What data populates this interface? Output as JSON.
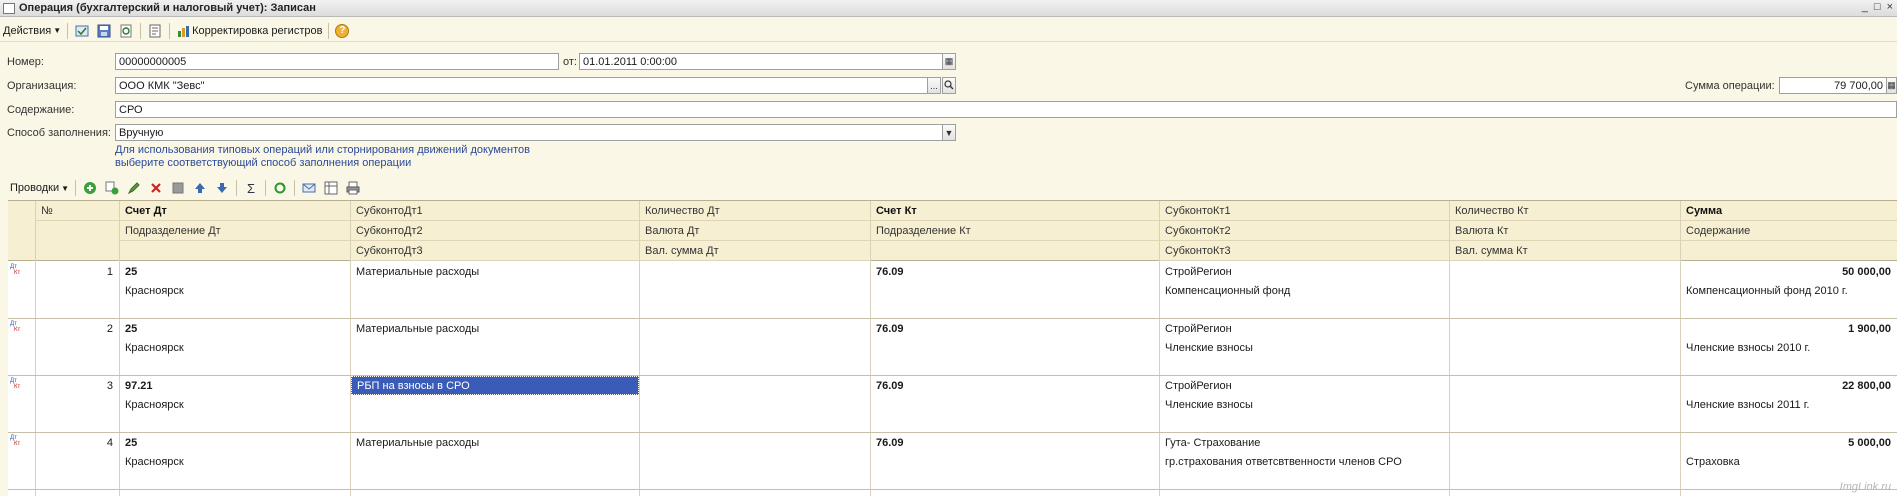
{
  "window": {
    "title": "Операция (бухгалтерский и налоговый учет): Записан",
    "controls": [
      "_",
      "□",
      "×"
    ]
  },
  "toolbar": {
    "actions_label": "Действия",
    "registers_label": "Корректировка регистров",
    "help_glyph": "?"
  },
  "form": {
    "number_label": "Номер:",
    "number_value": "00000000005",
    "date_label": "от:",
    "date_value": "01.01.2011  0:00:00",
    "org_label": "Организация:",
    "org_value": "ООО КМК \"Зевс\"",
    "org_select_glyph": "...",
    "sum_label": "Сумма операции:",
    "sum_value": "79 700,00",
    "content_label": "Содержание:",
    "content_value": "СРО",
    "fill_label": "Способ заполнения:",
    "fill_value": "Вручную",
    "hint_line1": "Для использования типовых операций или сторнирования движений документов",
    "hint_line2": "выберите соответствующий способ заполнения операции"
  },
  "entries_toolbar": {
    "label": "Проводки"
  },
  "grid": {
    "headers": {
      "num": "№",
      "dt_account": "Счет Дт",
      "dt_division": "Подразделение Дт",
      "dt_sub1": "СубконтоДт1",
      "dt_sub2": "СубконтоДт2",
      "dt_sub3": "СубконтоДт3",
      "dt_qty": "Количество Дт",
      "dt_currency": "Валюта Дт",
      "dt_cur_sum": "Вал. сумма Дт",
      "kt_account": "Счет Кт",
      "kt_division": "Подразделение Кт",
      "kt_sub1": "СубконтоКт1",
      "kt_sub2": "СубконтоКт2",
      "kt_sub3": "СубконтоКт3",
      "kt_qty": "Количество Кт",
      "kt_currency": "Валюта Кт",
      "kt_cur_sum": "Вал. сумма Кт",
      "sum": "Сумма",
      "content": "Содержание"
    },
    "rows": [
      {
        "icon_dt": "Дт",
        "icon_kt": "Кт",
        "num": "1",
        "dt_account": "25",
        "dt_division": "Красноярск",
        "dt_sub1": "Материальные расходы",
        "kt_account": "76.09",
        "kt_sub1": "СтройРегион",
        "kt_sub2": "Компенсационный фонд",
        "sum": "50 000,00",
        "content": "Компенсационный фонд 2010 г."
      },
      {
        "icon_dt": "Дт",
        "icon_kt": "Кт",
        "num": "2",
        "dt_account": "25",
        "dt_division": "Красноярск",
        "dt_sub1": "Материальные расходы",
        "kt_account": "76.09",
        "kt_sub1": "СтройРегион",
        "kt_sub2": "Членские взносы",
        "sum": "1 900,00",
        "content": "Членские взносы 2010 г."
      },
      {
        "icon_dt": "Дт",
        "icon_kt": "Кт",
        "num": "3",
        "dt_account": "97.21",
        "dt_division": "Красноярск",
        "dt_sub1": "РБП на взносы в СРО",
        "kt_account": "76.09",
        "kt_sub1": "СтройРегион",
        "kt_sub2": "Членские взносы",
        "sum": "22 800,00",
        "content": "Членские взносы 2011 г."
      },
      {
        "icon_dt": "Дт",
        "icon_kt": "Кт",
        "num": "4",
        "dt_account": "25",
        "dt_division": "Красноярск",
        "dt_sub1": "Материальные расходы",
        "kt_account": "76.09",
        "kt_sub1": "Гута- Страхование",
        "kt_sub2": "гр.страхования ответсвтвенности членов СРО",
        "sum": "5 000,00",
        "content": "Страховка"
      }
    ]
  },
  "watermark": "ImgLink.ru",
  "colors": {
    "background": "#fbf7e6",
    "header_bg": "#f6efd2",
    "selection": "#3a5cb8",
    "hint_text": "#2a4a9a"
  }
}
